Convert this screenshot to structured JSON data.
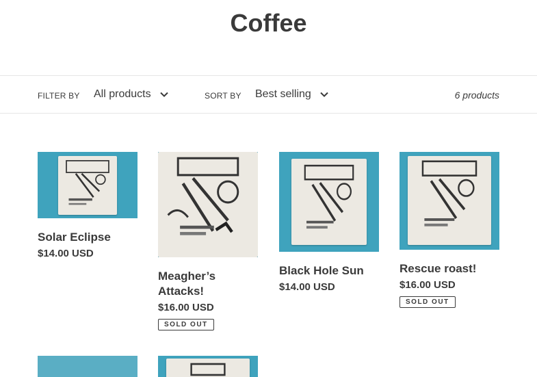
{
  "collection": {
    "title": "Coffee"
  },
  "filter_bar": {
    "filter_label": "FILTER BY",
    "filter_value": "All products",
    "sort_label": "SORT BY",
    "sort_value": "Best selling",
    "product_count": "6 products"
  },
  "products": [
    {
      "name": "Solar Eclipse",
      "price": "$14.00 USD",
      "sold_out": ""
    },
    {
      "name": "Meagher’s Attacks!",
      "price": "$16.00 USD",
      "sold_out": "SOLD OUT"
    },
    {
      "name": "Black Hole Sun",
      "price": "$14.00 USD",
      "sold_out": ""
    },
    {
      "name": "Rescue roast!",
      "price": "$16.00 USD",
      "sold_out": "SOLD OUT"
    },
    {
      "name": "",
      "price": "",
      "sold_out": ""
    },
    {
      "name": "",
      "price": "",
      "sold_out": ""
    }
  ],
  "colors": {
    "thumb_bg": "#3fa3bd",
    "text": "#3a3a3a",
    "bag": "#ece9e2"
  },
  "icons": {
    "dropdown": "chevron-down-icon"
  }
}
